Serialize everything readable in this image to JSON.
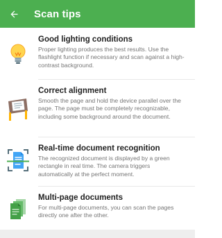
{
  "appbar": {
    "title": "Scan tips",
    "color": "#4caf50",
    "back_icon": "arrow-left-icon"
  },
  "tips": [
    {
      "icon": "lightbulb-icon",
      "title": "Good lighting conditions",
      "description": "Proper lighting produces the best results. Use the flashlight function if necessary and scan against a high-contrast background."
    },
    {
      "icon": "desk-document-icon",
      "title": "Correct alignment",
      "description": "Smooth the page and hold the device parallel over the page. The page must be completely recognizable, including some background around the document."
    },
    {
      "icon": "document-scan-icon",
      "title": "Real-time document recognition",
      "description": "The recognized document is displayed by a green rectangle in real time. The camera triggers automatically at the perfect moment."
    },
    {
      "icon": "multi-page-document-icon",
      "title": "Multi-page documents",
      "description": "For multi-page documents, you can scan the pages directly one after the other."
    }
  ]
}
